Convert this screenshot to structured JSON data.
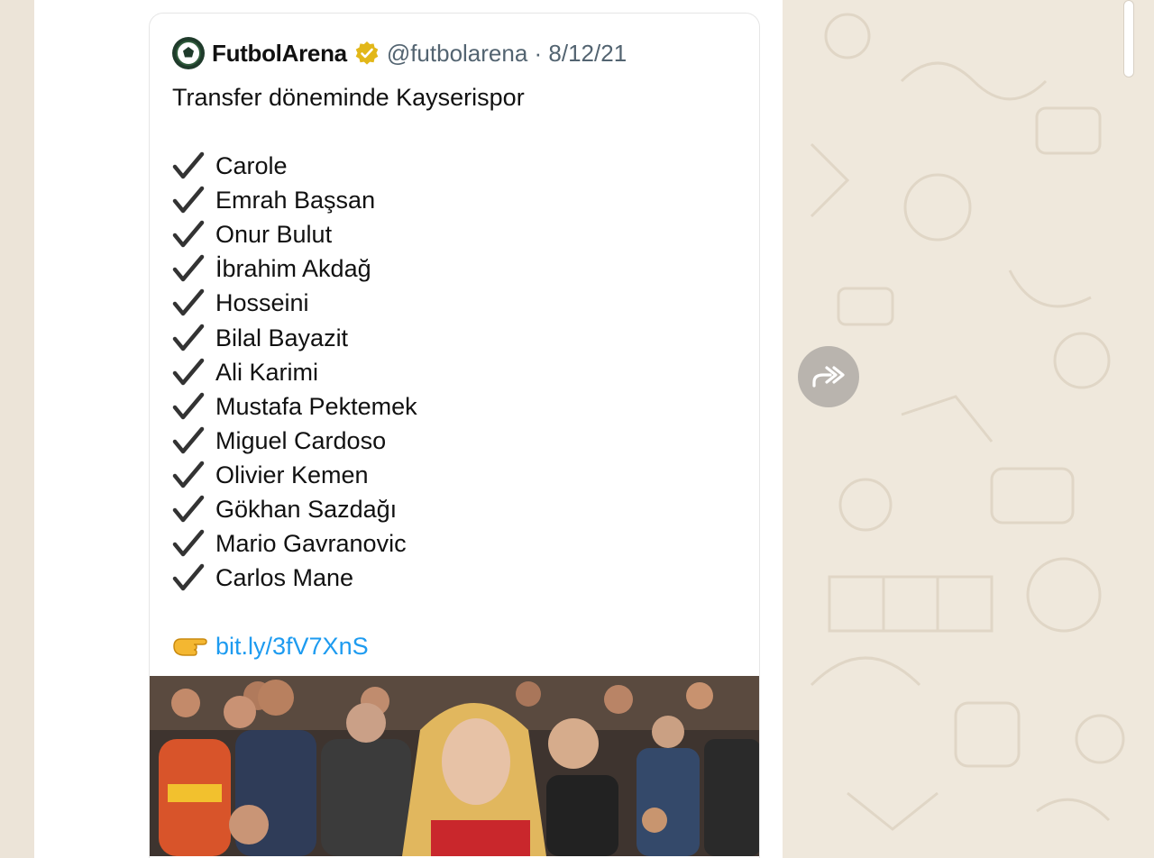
{
  "tweet": {
    "author_name": "FutbolArena",
    "handle_date": "@futbolarena · 8/12/21",
    "intro": "Transfer döneminde Kayserispor",
    "players": [
      "Carole",
      "Emrah Başsan",
      "Onur Bulut",
      "İbrahim Akdağ",
      "Hosseini",
      "Bilal Bayazit",
      "Ali Karimi",
      "Mustafa Pektemek",
      "Miguel Cardoso",
      "Olivier Kemen",
      "Gökhan Sazdağı",
      "Mario Gavranovic",
      "Carlos Mane"
    ],
    "link_text": "bit.ly/3fV7XnS",
    "icons": {
      "avatar": "futbolarena-logo-icon",
      "verified": "verified-badge-icon",
      "check": "check-mark-icon",
      "pointer": "pointing-hand-icon"
    }
  },
  "forward_icon": "forward-arrow-icon",
  "colors": {
    "link": "#1d9bf0",
    "verified_gold": "#e2b719",
    "chat_background": "#efe8dc",
    "forward_button": "#b9b4ae"
  }
}
